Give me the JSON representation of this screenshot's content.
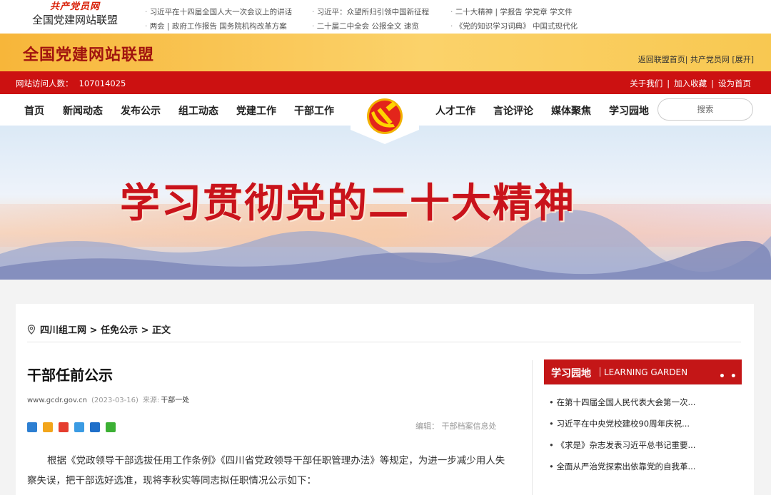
{
  "top": {
    "brand_script": "共产党员网",
    "brand_name": "全国党建网站联盟",
    "links_col1": [
      "习近平在十四届全国人大一次会议上的讲话",
      "两会 | 政府工作报告  国务院机构改革方案"
    ],
    "links_col2": [
      "习近平：众望所归引领中国新征程",
      "二十届二中全会  公报全文  速览"
    ],
    "links_col3": [
      "二十大精神 | 学报告  学党章  学文件",
      "《党的知识学习词典》  中国式现代化"
    ]
  },
  "banner": {
    "title": "全国党建网站联盟",
    "links": "返回联盟首页| 共产党员网  [展开]"
  },
  "infobar": {
    "visits_label": "网站访问人数：",
    "visits_count": "107014025",
    "about": "关于我们",
    "bookmark": "加入收藏",
    "homepage": "设为首页"
  },
  "nav": {
    "items_left": [
      "首页",
      "新闻动态",
      "发布公示",
      "组工动态",
      "党建工作",
      "干部工作"
    ],
    "items_right": [
      "人才工作",
      "言论评论",
      "媒体聚焦",
      "学习园地"
    ],
    "search_placeholder": "搜索"
  },
  "hero": {
    "slogan": "学习贯彻党的二十大精神"
  },
  "breadcrumb": {
    "a": "四川组工网",
    "sep1": ">",
    "b": "任免公示",
    "sep2": ">",
    "c": "正文"
  },
  "article": {
    "title": "干部任前公示",
    "source_site": "www.gcdr.gov.cn",
    "date": "(2023-03-16)",
    "source_label": "来源:",
    "source_value": "干部一处",
    "editor": "编辑：  干部档案信息处",
    "body": "根据《党政领导干部选拔任用工作条例》《四川省党政领导干部任职管理办法》等规定，为进一步减少用人失察失误，把干部选好选准，现将李秋实等同志拟任职情况公示如下："
  },
  "side": {
    "title_cn": "学习园地",
    "title_en": "LEARNING GARDEN",
    "more": "• • •",
    "items": [
      "在第十四届全国人民代表大会第一次...",
      "习近平在中央党校建校90周年庆祝...",
      "《求是》杂志发表习近平总书记重要...",
      "全面从严治党探索出依靠党的自我革..."
    ]
  },
  "colors": {
    "party_red": "#cc1111",
    "gold": "#f8c851",
    "title_red": "#a1140f"
  }
}
